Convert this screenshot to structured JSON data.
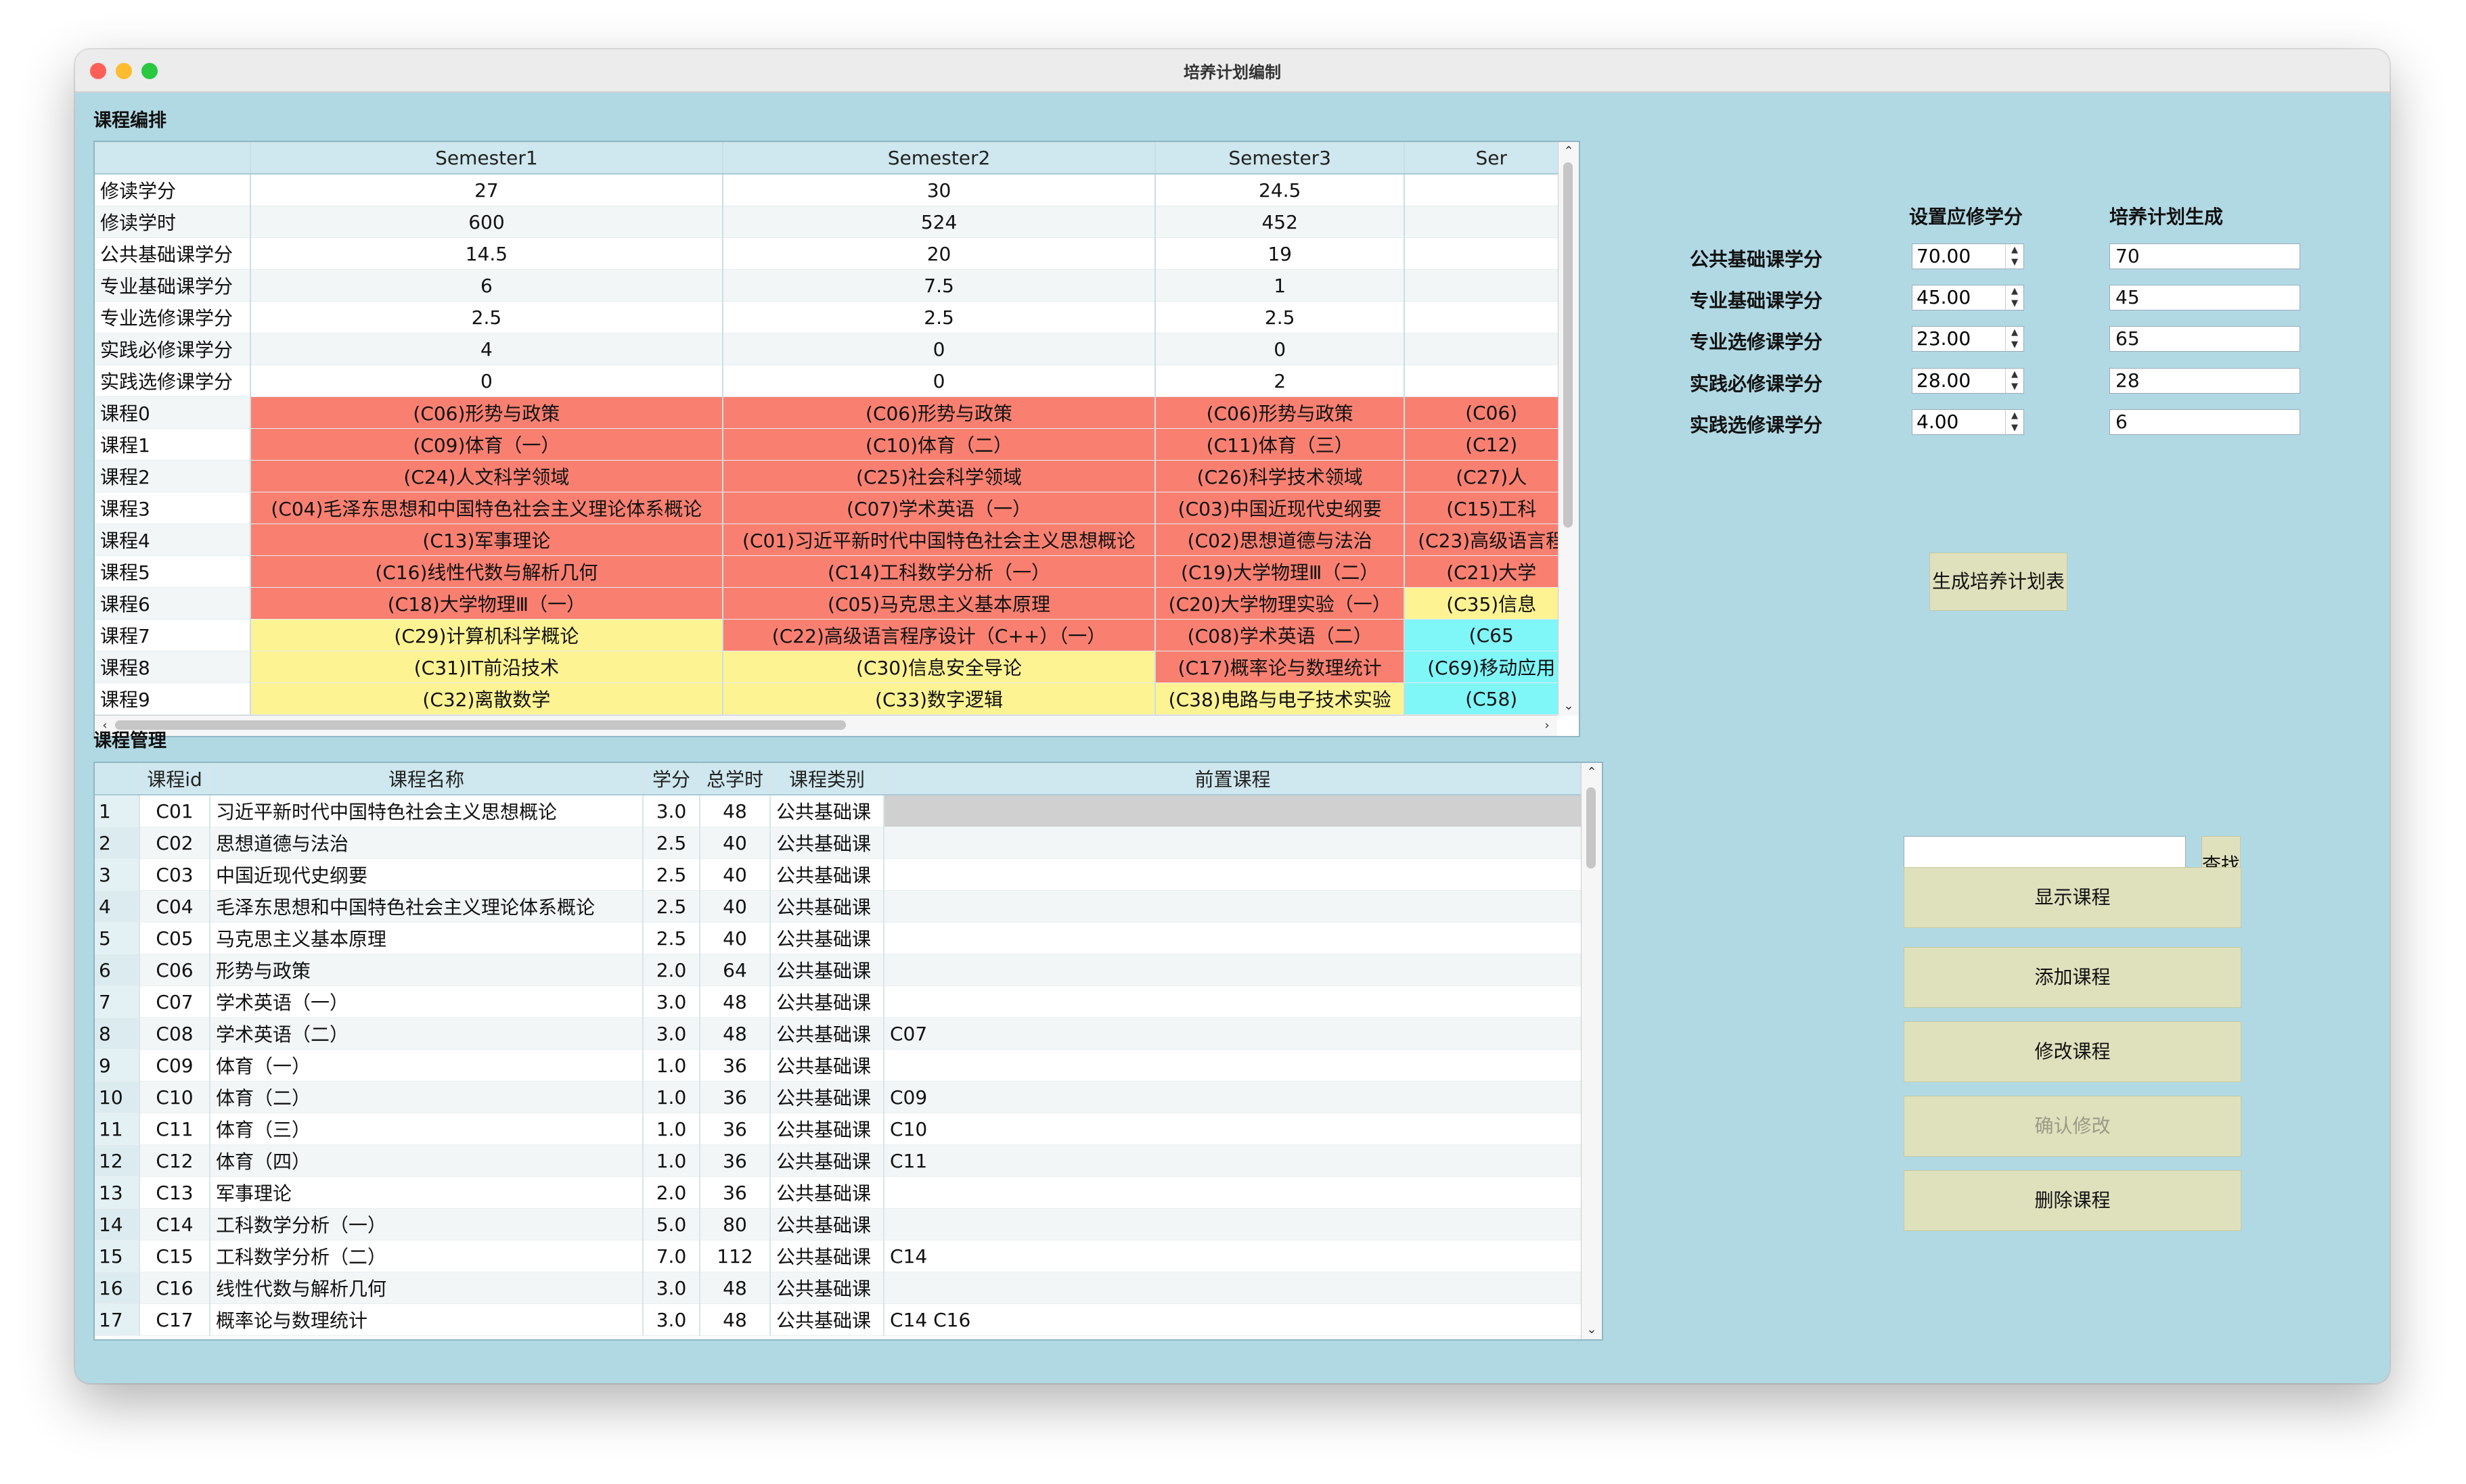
{
  "window": {
    "title": "培养计划编制"
  },
  "semester_group": {
    "label": "课程编排",
    "columns": [
      "",
      "Semester1",
      "Semester2",
      "Semester3",
      "Ser"
    ],
    "rows": [
      {
        "label": "修读学分",
        "cells": [
          "27",
          "30",
          "24.5",
          ""
        ],
        "colors": [
          "",
          "",
          "",
          ""
        ]
      },
      {
        "label": "修读学时",
        "cells": [
          "600",
          "524",
          "452",
          ""
        ],
        "colors": [
          "",
          "",
          "",
          ""
        ]
      },
      {
        "label": "公共基础课学分",
        "cells": [
          "14.5",
          "20",
          "19",
          ""
        ],
        "colors": [
          "",
          "",
          "",
          ""
        ]
      },
      {
        "label": "专业基础课学分",
        "cells": [
          "6",
          "7.5",
          "1",
          ""
        ],
        "colors": [
          "",
          "",
          "",
          ""
        ]
      },
      {
        "label": "专业选修课学分",
        "cells": [
          "2.5",
          "2.5",
          "2.5",
          ""
        ],
        "colors": [
          "",
          "",
          "",
          ""
        ]
      },
      {
        "label": "实践必修课学分",
        "cells": [
          "4",
          "0",
          "0",
          ""
        ],
        "colors": [
          "",
          "",
          "",
          ""
        ]
      },
      {
        "label": "实践选修课学分",
        "cells": [
          "0",
          "0",
          "2",
          ""
        ],
        "colors": [
          "",
          "",
          "",
          ""
        ]
      },
      {
        "label": "课程0",
        "cells": [
          "(C06)形势与政策",
          "(C06)形势与政策",
          "(C06)形势与政策",
          "(C06)"
        ],
        "colors": [
          "red",
          "red",
          "red",
          "red"
        ]
      },
      {
        "label": "课程1",
        "cells": [
          "(C09)体育（一）",
          "(C10)体育（二）",
          "(C11)体育（三）",
          "(C12)"
        ],
        "colors": [
          "red",
          "red",
          "red",
          "red"
        ]
      },
      {
        "label": "课程2",
        "cells": [
          "(C24)人文科学领域",
          "(C25)社会科学领域",
          "(C26)科学技术领域",
          "(C27)人"
        ],
        "colors": [
          "red",
          "red",
          "red",
          "red"
        ]
      },
      {
        "label": "课程3",
        "cells": [
          "(C04)毛泽东思想和中国特色社会主义理论体系概论",
          "(C07)学术英语（一）",
          "(C03)中国近现代史纲要",
          "(C15)工科"
        ],
        "colors": [
          "red",
          "red",
          "red",
          "red"
        ]
      },
      {
        "label": "课程4",
        "cells": [
          "(C13)军事理论",
          "(C01)习近平新时代中国特色社会主义思想概论",
          "(C02)思想道德与法治",
          "(C23)高级语言程"
        ],
        "colors": [
          "red",
          "red",
          "red",
          "red"
        ]
      },
      {
        "label": "课程5",
        "cells": [
          "(C16)线性代数与解析几何",
          "(C14)工科数学分析（一）",
          "(C19)大学物理Ⅲ（二）",
          "(C21)大学"
        ],
        "colors": [
          "red",
          "red",
          "red",
          "red"
        ]
      },
      {
        "label": "课程6",
        "cells": [
          "(C18)大学物理Ⅲ（一）",
          "(C05)马克思主义基本原理",
          "(C20)大学物理实验（一）",
          "(C35)信息"
        ],
        "colors": [
          "red",
          "red",
          "red",
          "yellow"
        ]
      },
      {
        "label": "课程7",
        "cells": [
          "(C29)计算机科学概论",
          "(C22)高级语言程序设计（C++）（一）",
          "(C08)学术英语（二）",
          "(C65"
        ],
        "colors": [
          "yellow",
          "red",
          "red",
          "cyan"
        ]
      },
      {
        "label": "课程8",
        "cells": [
          "(C31)IT前沿技术",
          "(C30)信息安全导论",
          "(C17)概率论与数理统计",
          "(C69)移动应用"
        ],
        "colors": [
          "yellow",
          "yellow",
          "red",
          "cyan"
        ]
      },
      {
        "label": "课程9",
        "cells": [
          "(C32)离散数学",
          "(C33)数字逻辑",
          "(C38)电路与电子技术实验",
          "(C58)"
        ],
        "colors": [
          "yellow",
          "yellow",
          "yellow",
          "cyan"
        ]
      }
    ]
  },
  "course_group": {
    "label": "课程管理",
    "columns": [
      "",
      "课程id",
      "课程名称",
      "学分",
      "总学时",
      "课程类别",
      "前置课程"
    ],
    "rows": [
      {
        "idx": "1",
        "id": "C01",
        "name": "习近平新时代中国特色社会主义思想概论",
        "credit": "3.0",
        "hours": "48",
        "type": "公共基础课",
        "prereq": ""
      },
      {
        "idx": "2",
        "id": "C02",
        "name": "思想道德与法治",
        "credit": "2.5",
        "hours": "40",
        "type": "公共基础课",
        "prereq": ""
      },
      {
        "idx": "3",
        "id": "C03",
        "name": "中国近现代史纲要",
        "credit": "2.5",
        "hours": "40",
        "type": "公共基础课",
        "prereq": ""
      },
      {
        "idx": "4",
        "id": "C04",
        "name": "毛泽东思想和中国特色社会主义理论体系概论",
        "credit": "2.5",
        "hours": "40",
        "type": "公共基础课",
        "prereq": ""
      },
      {
        "idx": "5",
        "id": "C05",
        "name": "马克思主义基本原理",
        "credit": "2.5",
        "hours": "40",
        "type": "公共基础课",
        "prereq": ""
      },
      {
        "idx": "6",
        "id": "C06",
        "name": "形势与政策",
        "credit": "2.0",
        "hours": "64",
        "type": "公共基础课",
        "prereq": ""
      },
      {
        "idx": "7",
        "id": "C07",
        "name": "学术英语（一）",
        "credit": "3.0",
        "hours": "48",
        "type": "公共基础课",
        "prereq": ""
      },
      {
        "idx": "8",
        "id": "C08",
        "name": "学术英语（二）",
        "credit": "3.0",
        "hours": "48",
        "type": "公共基础课",
        "prereq": "C07"
      },
      {
        "idx": "9",
        "id": "C09",
        "name": "体育（一）",
        "credit": "1.0",
        "hours": "36",
        "type": "公共基础课",
        "prereq": ""
      },
      {
        "idx": "10",
        "id": "C10",
        "name": "体育（二）",
        "credit": "1.0",
        "hours": "36",
        "type": "公共基础课",
        "prereq": "C09"
      },
      {
        "idx": "11",
        "id": "C11",
        "name": "体育（三）",
        "credit": "1.0",
        "hours": "36",
        "type": "公共基础课",
        "prereq": "C10"
      },
      {
        "idx": "12",
        "id": "C12",
        "name": "体育（四）",
        "credit": "1.0",
        "hours": "36",
        "type": "公共基础课",
        "prereq": "C11"
      },
      {
        "idx": "13",
        "id": "C13",
        "name": "军事理论",
        "credit": "2.0",
        "hours": "36",
        "type": "公共基础课",
        "prereq": ""
      },
      {
        "idx": "14",
        "id": "C14",
        "name": "工科数学分析（一）",
        "credit": "5.0",
        "hours": "80",
        "type": "公共基础课",
        "prereq": ""
      },
      {
        "idx": "15",
        "id": "C15",
        "name": "工科数学分析（二）",
        "credit": "7.0",
        "hours": "112",
        "type": "公共基础课",
        "prereq": "C14"
      },
      {
        "idx": "16",
        "id": "C16",
        "name": "线性代数与解析几何",
        "credit": "3.0",
        "hours": "48",
        "type": "公共基础课",
        "prereq": ""
      },
      {
        "idx": "17",
        "id": "C17",
        "name": "概率论与数理统计",
        "credit": "3.0",
        "hours": "48",
        "type": "公共基础课",
        "prereq": "C14 C16"
      }
    ]
  },
  "credit_settings": {
    "header_required": "设置应修学分",
    "header_generated": "培养计划生成",
    "items": [
      {
        "label": "公共基础课学分",
        "required": "70.00",
        "generated": "70"
      },
      {
        "label": "专业基础课学分",
        "required": "45.00",
        "generated": "45"
      },
      {
        "label": "专业选修课学分",
        "required": "23.00",
        "generated": "65"
      },
      {
        "label": "实践必修课学分",
        "required": "28.00",
        "generated": "28"
      },
      {
        "label": "实践选修课学分",
        "required": "4.00",
        "generated": "6"
      }
    ]
  },
  "actions": {
    "generate": "生成培养计划表",
    "search": "查找",
    "show": "显示课程",
    "add": "添加课程",
    "modify": "修改课程",
    "confirm": "确认修改",
    "delete": "删除课程"
  },
  "colors": {
    "window_bg": "#b1d9e4",
    "cell_red": "#f98071",
    "cell_yellow": "#fdf392",
    "cell_cyan": "#7ff6f8",
    "button_bg": "#dfe1bd"
  }
}
